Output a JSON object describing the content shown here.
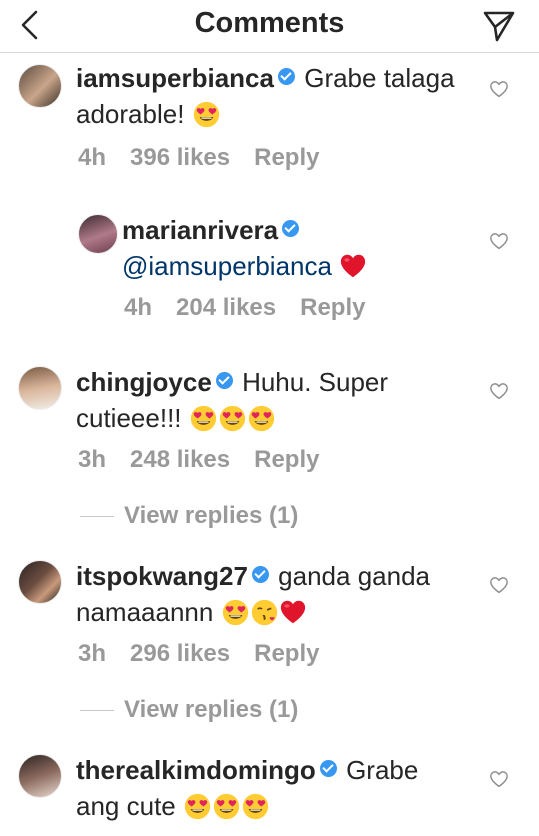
{
  "header": {
    "title": "Comments"
  },
  "comments": [
    {
      "username": "iamsuperbianca",
      "text": "Grabe talaga adorable!",
      "time": "4h",
      "likes": "396 likes",
      "reply": "Reply"
    },
    {
      "username": "marianrivera",
      "mention": "@iamsuperbianca",
      "time": "4h",
      "likes": "204 likes",
      "reply": "Reply"
    },
    {
      "username": "chingjoyce",
      "text_line1": "Huhu. Super",
      "text_line2": "cutieee!!!",
      "time": "3h",
      "likes": "248 likes",
      "reply": "Reply",
      "view_replies": "View replies (1)"
    },
    {
      "username": "itspokwang27",
      "text_line1": "ganda ganda",
      "text_line2": "namaaannn",
      "time": "3h",
      "likes": "296 likes",
      "reply": "Reply",
      "view_replies": "View replies (1)"
    },
    {
      "username": "therealkimdomingo",
      "text_line1": "Grabe",
      "text_line2": "ang cute"
    }
  ],
  "colors": {
    "text": "#262626",
    "muted": "#999999",
    "verified": "#3897f0",
    "mention": "#003569",
    "heart": "#ed4956",
    "emoji_face": "#ffcc33"
  },
  "icons": [
    "back-chevron-icon",
    "send-icon",
    "verified-badge-icon",
    "heart-outline-icon",
    "heart-eyes-emoji",
    "red-heart-emoji",
    "kissing-heart-emoji"
  ]
}
